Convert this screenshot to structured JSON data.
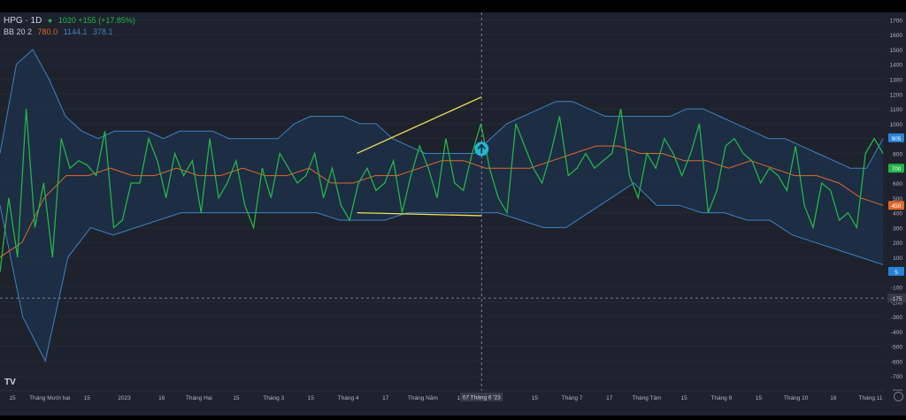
{
  "legend": {
    "symbol": "HPG · 1D",
    "price_text": "1020 +155 (+17.85%)",
    "bb_label": "BB 20 2",
    "bb_basis": "780.0",
    "bb_upper": "1144.1",
    "bb_lower": "378.1"
  },
  "colors": {
    "background": "#1e222d",
    "price": "#22b548",
    "basis": "#e0682c",
    "band": "#3d82c4",
    "band_fill": "#1d2f48",
    "trend": "#f2e05a",
    "crosshair": "#9598a1",
    "marker": "#26b5d0"
  },
  "icons": {
    "marker": "up-arrow-icon",
    "logo": "tradingview-logo-icon",
    "settings": "gear-icon"
  },
  "tv_logo": "TV",
  "chart_data": {
    "type": "line",
    "title": "HPG · 1D",
    "ylim": [
      -800,
      1750
    ],
    "y_ticks": [
      1700,
      1600,
      1500,
      1400,
      1300,
      1200,
      1100,
      1000,
      900,
      800,
      700,
      600,
      500,
      400,
      300,
      200,
      100,
      -100,
      -200,
      -300,
      -400,
      -500,
      -600,
      -700,
      -800
    ],
    "x_tick_labels": [
      "15",
      "Tháng Mười hai",
      "15",
      "2023",
      "16",
      "Tháng Hai",
      "15",
      "Tháng 3",
      "15",
      "Tháng 4",
      "17",
      "Tháng Năm",
      "15",
      "07 Tháng 6 '23",
      "15",
      "Tháng 7",
      "17",
      "Tháng Tám",
      "15",
      "Tháng 9",
      "15",
      "Tháng 10",
      "18",
      "Tháng 11"
    ],
    "crosshair_date": "07 Tháng 6 '23",
    "crosshair_price": "-175",
    "price_badges": [
      {
        "text": "905",
        "value": 905
      },
      {
        "text": "700",
        "value": 700
      },
      {
        "text": "450",
        "value": 450
      },
      {
        "text": "5",
        "value": 5
      }
    ],
    "series": [
      {
        "name": "HPG",
        "values": [
          0,
          500,
          100,
          1100,
          300,
          600,
          100,
          900,
          700,
          750,
          720,
          650,
          950,
          300,
          350,
          600,
          600,
          900,
          750,
          500,
          800,
          650,
          750,
          400,
          900,
          500,
          600,
          750,
          450,
          300,
          700,
          500,
          800,
          700,
          600,
          650,
          800,
          500,
          700,
          450,
          350,
          600,
          700,
          550,
          600,
          750,
          400,
          650,
          850,
          700,
          500,
          900,
          600,
          550,
          800,
          1000,
          700,
          500,
          400,
          1000,
          850,
          700,
          600,
          800,
          1050,
          650,
          700,
          800,
          700,
          750,
          800,
          1100,
          650,
          500,
          800,
          700,
          900,
          800,
          650,
          800,
          1000,
          400,
          550,
          850,
          900,
          800,
          750,
          600,
          700,
          650,
          550,
          850,
          450,
          300,
          600,
          550,
          350,
          400,
          300,
          800,
          900,
          800
        ]
      },
      {
        "name": "BB upper",
        "values": [
          800,
          1400,
          1500,
          1300,
          1050,
          950,
          900,
          950,
          950,
          950,
          900,
          950,
          950,
          950,
          900,
          900,
          900,
          900,
          1000,
          1050,
          1050,
          1050,
          1000,
          1000,
          900,
          850,
          800,
          800,
          800,
          800,
          900,
          1000,
          1050,
          1100,
          1150,
          1150,
          1100,
          1050,
          1050,
          1050,
          1050,
          1050,
          1100,
          1100,
          1050,
          1000,
          950,
          900,
          900,
          850,
          800,
          750,
          700,
          700,
          900
        ]
      },
      {
        "name": "Basis",
        "values": [
          100,
          200,
          500,
          650,
          650,
          700,
          650,
          650,
          700,
          650,
          650,
          700,
          650,
          650,
          700,
          600,
          600,
          650,
          650,
          700,
          750,
          750,
          700,
          700,
          700,
          750,
          800,
          850,
          850,
          800,
          800,
          750,
          750,
          700,
          750,
          700,
          650,
          650,
          600,
          500,
          450
        ]
      },
      {
        "name": "BB lower",
        "values": [
          450,
          -300,
          -600,
          100,
          300,
          250,
          300,
          350,
          400,
          400,
          400,
          400,
          400,
          400,
          400,
          350,
          350,
          350,
          400,
          400,
          400,
          400,
          400,
          350,
          300,
          300,
          400,
          500,
          600,
          450,
          450,
          400,
          400,
          350,
          350,
          250,
          200,
          150,
          100,
          50
        ]
      }
    ],
    "trendlines": [
      {
        "from": {
          "x": "Tháng 4",
          "y": 800
        },
        "to": {
          "x": "07 Tháng 6 '23",
          "y": 1180
        }
      },
      {
        "from": {
          "x": "Tháng 4",
          "y": 400
        },
        "to": {
          "x": "07 Tháng 6 '23",
          "y": 380
        }
      }
    ]
  }
}
